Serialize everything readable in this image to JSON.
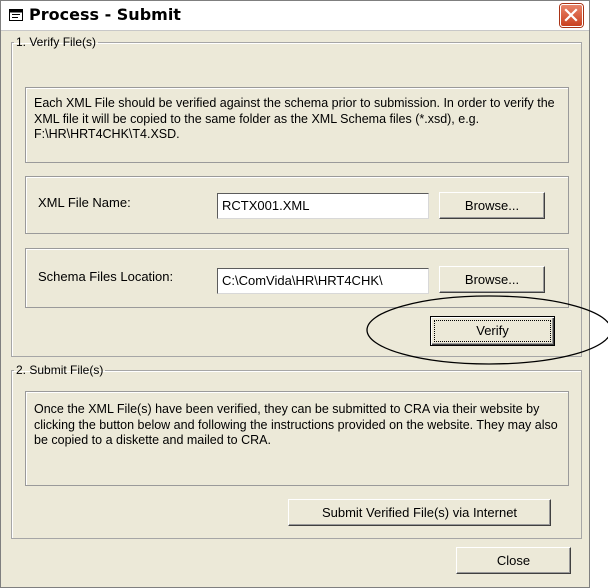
{
  "window": {
    "title": "Process - Submit"
  },
  "verify_section": {
    "legend": "1. Verify File(s)",
    "description": "Each XML File should be verified against the schema prior to submission. In order to verify the XML file it will be copied to the same folder as the XML Schema files (*.xsd), e.g. F:\\HR\\HRT4CHK\\T4.XSD.",
    "xml_file_label": "XML File Name:",
    "xml_file_value": "RCTX001.XML",
    "browse_label": "Browse...",
    "schema_label": "Schema Files Location:",
    "schema_value": "C:\\ComVida\\HR\\HRT4CHK\\",
    "verify_label": "Verify"
  },
  "submit_section": {
    "legend": "2. Submit File(s)",
    "description": "Once the XML File(s) have been verified, they can be submitted to CRA via their website by clicking the button below and following the instructions provided on the website.  They may also be copied to a diskette and mailed to CRA.",
    "submit_label": "Submit Verified File(s) via Internet"
  },
  "footer": {
    "close_label": "Close"
  },
  "icons": {
    "title_icon": "window-app-icon",
    "close_icon": "close-x-icon"
  },
  "colors": {
    "window_bg": "#ece9d8",
    "close_button": "#d4502e"
  }
}
